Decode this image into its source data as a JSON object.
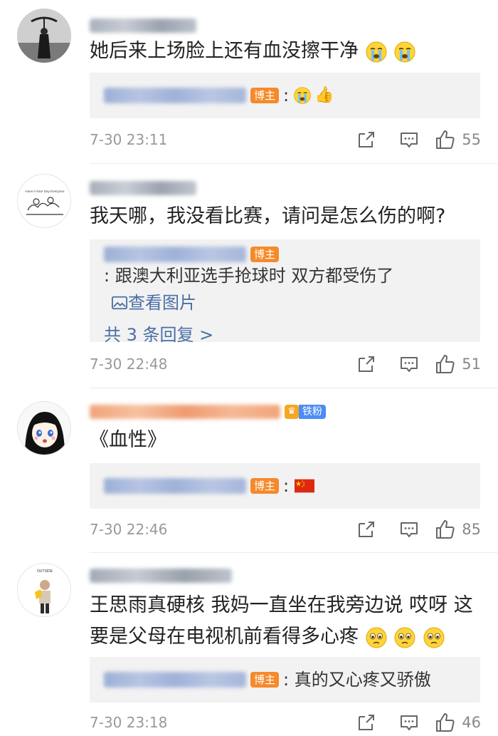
{
  "comments": [
    {
      "text": "她后来上场脸上还有血没擦干净",
      "reply": {
        "badge": "博主",
        "text": ":"
      },
      "time": "7-30 23:11",
      "likes": "55"
    },
    {
      "text": "我天哪，我没看比赛，请问是怎么伤的啊?",
      "reply": {
        "badge": "博主",
        "text": ": 跟澳大利亚选手抢球时 双方都受伤了",
        "link": "查看图片",
        "more": "共 3 条回复 >"
      },
      "time": "7-30 22:48",
      "likes": "51"
    },
    {
      "text": "《血性》",
      "fan_badge": "铁粉",
      "reply": {
        "badge": "博主",
        "text": ":"
      },
      "time": "7-30 22:46",
      "likes": "85"
    },
    {
      "text": "王思雨真硬核 我妈一直坐在我旁边说 哎呀 这要是父母在电视机前看得多心疼",
      "reply": {
        "badge": "博主",
        "text": ": 真的又心疼又骄傲"
      },
      "time": "7-30 23:18",
      "likes": "46"
    }
  ],
  "avatar2_caption": "Have A Nice Day Everyone",
  "avatar4_caption": "OUTSIDE",
  "colors": {
    "accent": "#4a6fa5",
    "badge": "#f58a2a",
    "fan": "#4c8cf5"
  }
}
